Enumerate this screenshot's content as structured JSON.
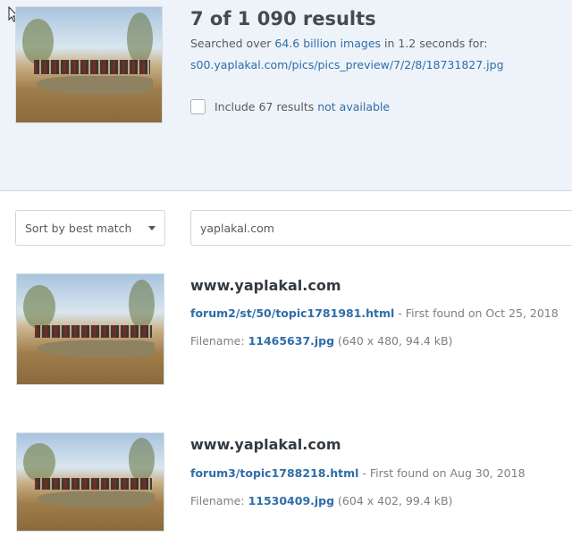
{
  "header": {
    "title": "7 of 1 090 results",
    "searched_prefix": "Searched over ",
    "searched_count": "64.6 billion images",
    "searched_suffix": " in 1.2 seconds for:",
    "query_url": "s00.yaplakal.com/pics/pics_preview/7/2/8/18731827.jpg",
    "include_prefix": "Include 67 results ",
    "include_link": "not available"
  },
  "controls": {
    "sort_label": "Sort by best match",
    "filter_value": "yaplakal.com"
  },
  "results": [
    {
      "site": "www.yaplakal.com",
      "page_link": "forum2/st/50/topic1781981.html",
      "found_text": " - First found on Oct 25, 2018",
      "filename_label": "Filename: ",
      "filename": "11465637.jpg",
      "file_info": " (640 x 480, 94.4 kB)"
    },
    {
      "site": "www.yaplakal.com",
      "page_link": "forum3/topic1788218.html",
      "found_text": " - First found on Aug 30, 2018",
      "filename_label": "Filename: ",
      "filename": "11530409.jpg",
      "file_info": " (604 x 402, 99.4 kB)"
    }
  ],
  "colors": {
    "link": "#2f6da8",
    "header_bg": "#eef3fa"
  }
}
